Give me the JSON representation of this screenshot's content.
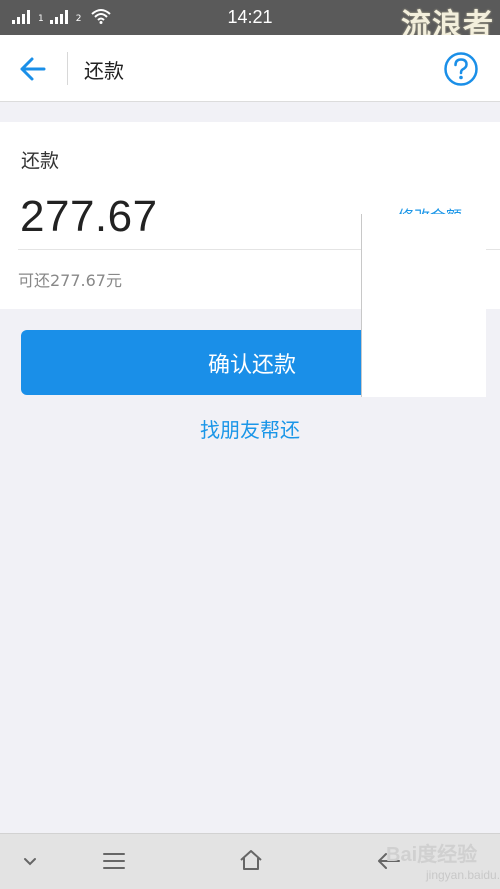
{
  "status_bar": {
    "time": "14:21",
    "sim1_label": "1",
    "sim2_label": "2",
    "watermark": "流浪者"
  },
  "header": {
    "title": "还款",
    "back_icon": "arrow-left-icon",
    "help_icon": "question-circle-icon"
  },
  "repay_card": {
    "label": "还款",
    "amount": "277.67",
    "available": "可还277.67元",
    "modify_link": "修改金额"
  },
  "actions": {
    "confirm_label": "确认还款",
    "friend_label": "找朋友帮还"
  },
  "bottom_nav": {
    "items": [
      "chevron-down-icon",
      "menu-icon",
      "home-icon",
      "back-icon"
    ],
    "watermark": "Bai度经验",
    "watermark_sub": "jingyan.baidu.com"
  },
  "colors": {
    "accent": "#1a8fe8",
    "link": "#1a96e8",
    "page_bg": "#f1f1f6"
  }
}
